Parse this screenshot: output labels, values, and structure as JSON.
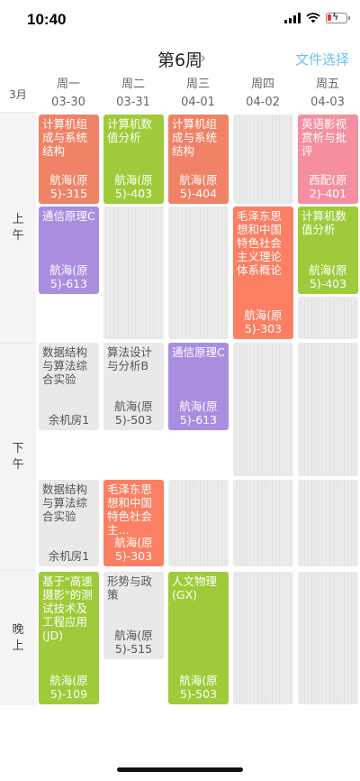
{
  "status": {
    "time": "10:40"
  },
  "header": {
    "week_title": "第6周",
    "arrow": "›",
    "file_select": "文件选择"
  },
  "month": "3月",
  "days": [
    {
      "name": "周一",
      "date": "03-30"
    },
    {
      "name": "周二",
      "date": "03-31"
    },
    {
      "name": "周三",
      "date": "04-01"
    },
    {
      "name": "周四",
      "date": "04-02"
    },
    {
      "name": "周五",
      "date": "04-03"
    }
  ],
  "periods": [
    {
      "chars": [
        "上",
        "午"
      ]
    },
    {
      "chars": [
        "下",
        "午"
      ]
    },
    {
      "chars": [
        "晚",
        "上"
      ]
    }
  ],
  "courses": [
    {
      "name": "计算机组成与系统结构",
      "room": "航海(原5)-315",
      "color": "#f08266"
    },
    {
      "name": "计算机数值分析",
      "room": "航海(原5)-403",
      "color": "#9fcb3a"
    },
    {
      "name": "计算机组成与系统结构",
      "room": "航海(原5)-404",
      "color": "#f08266"
    },
    {
      "name": "英语影视赏析与批评",
      "room": "西配(原2)-401",
      "color": "#f58fa0"
    },
    {
      "name": "通信原理C",
      "room": "航海(原5)-613",
      "color": "#a98ee0"
    },
    {
      "name": "毛泽东思想和中国特色社会主义理论体系概论",
      "room": "航海(原5)-303",
      "color": "#fb7f63"
    },
    {
      "name": "计算机数值分析",
      "room": "航海(原5)-403",
      "color": "#9fcb3a"
    },
    {
      "name": "数据结构与算法综合实验",
      "room": "余机房1",
      "color": "#e9e9e9"
    },
    {
      "name": "算法设计与分析B",
      "room": "航海(原5)-503",
      "color": "#e9e9e9"
    },
    {
      "name": "通信原理C",
      "room": "航海(原5)-613",
      "color": "#a98ee0"
    },
    {
      "name": "数据结构与算法综合实验",
      "room": "余机房1",
      "color": "#e9e9e9"
    },
    {
      "name": "毛泽东思想和中国特色社会主...",
      "room": "航海(原5)-303",
      "color": "#fb7f63"
    },
    {
      "name": "基于\"高速摄影\"的测试技术及工程应用(JD)",
      "room": "航海(原5)-109",
      "color": "#9fcb3a"
    },
    {
      "name": "形势与政策",
      "room": "航海(原5)-515",
      "color": "#e9e9e9"
    },
    {
      "name": "人文物理(GX)",
      "room": "航海(原5)-503",
      "color": "#9fcb3a"
    }
  ]
}
